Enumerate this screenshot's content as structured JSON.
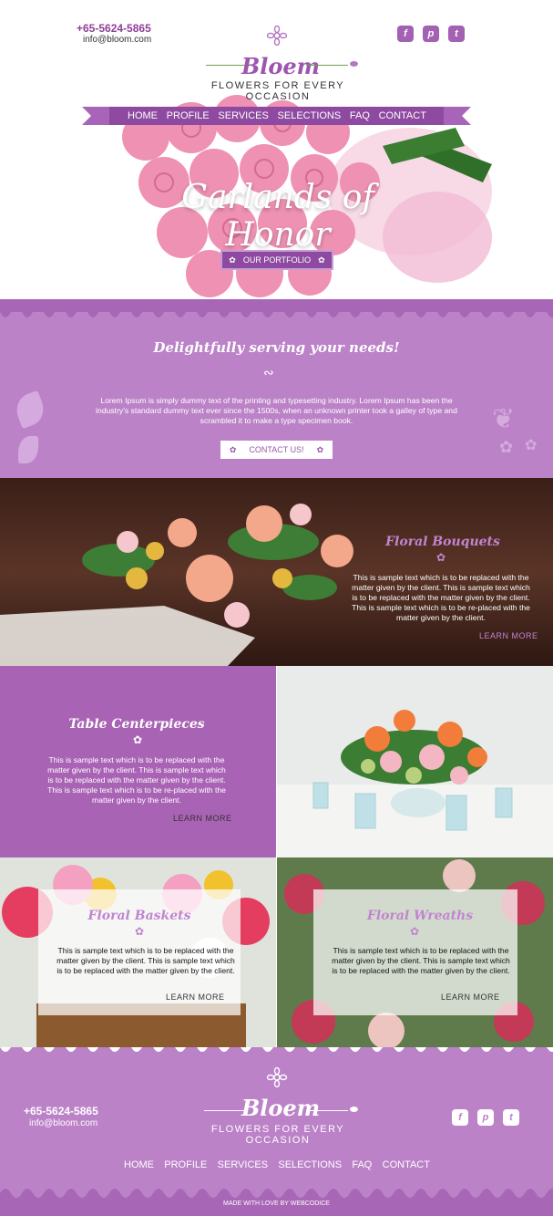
{
  "header": {
    "phone": "+65-5624-5865",
    "email": "info@bloom.com",
    "logo": "Bloem",
    "tagline": "FLOWERS  FOR  EVERY  OCCASION",
    "social": [
      "f",
      "p",
      "t"
    ]
  },
  "nav": [
    "HOME",
    "PROFILE",
    "SERVICES",
    "SELECTIONS",
    "FAQ",
    "CONTACT"
  ],
  "hero": {
    "title": "Garlands of Honor",
    "button": "OUR PORTFOLIO"
  },
  "intro": {
    "title": "Delightfully serving your needs!",
    "text": "Lorem Ipsum is simply dummy text of the printing and typesetting industry. Lorem Ipsum has been the industry's standard dummy text ever since the 1500s, when an unknown printer took a galley of type and scrambled it to make a type specimen book.",
    "button": "CONTACT US!"
  },
  "sections": {
    "bouquets": {
      "title": "Floral Bouquets",
      "text": "This is sample text which is to be replaced with the matter given by the client. This is sample text which is to be replaced with the matter given by the client. This is sample text which is to be re-placed with the matter given by the client.",
      "link": "LEARN MORE"
    },
    "centerpieces": {
      "title": "Table Centerpieces",
      "text": "This is sample text which is to be replaced with the matter given by the client. This is sample text which is to be replaced with the matter given by the client. This is sample text which is to be re-placed with the matter given by the client.",
      "link": "LEARN MORE"
    },
    "baskets": {
      "title": "Floral Baskets",
      "text": "This is sample text which is to be replaced with the matter given by the client. This is sample text which is to be replaced with the matter given by the client.",
      "link": "LEARN MORE"
    },
    "wreaths": {
      "title": "Floral Wreaths",
      "text": "This is sample text which is to be replaced with the matter given by the client. This is sample text which is to be replaced with the matter given by the client.",
      "link": "LEARN MORE"
    }
  },
  "footer": {
    "phone": "+65-5624-5865",
    "email": "info@bloom.com",
    "logo": "Bloem",
    "tagline": "FLOWERS  FOR  EVERY  OCCASION",
    "nav": [
      "HOME",
      "PROFILE",
      "SERVICES",
      "SELECTIONS",
      "FAQ",
      "CONTACT"
    ],
    "copyright": "MADE WITH LOVE BY WEBCODICE"
  },
  "colors": {
    "accent": "#bc82c8",
    "dark_accent": "#8e4aa0",
    "title_pink": "#c184d0"
  },
  "icons": [
    "lotus-icon",
    "facebook-icon",
    "pinterest-icon",
    "twitter-icon",
    "flower-bullet-icon",
    "butterfly-icon",
    "leaf-icon"
  ]
}
